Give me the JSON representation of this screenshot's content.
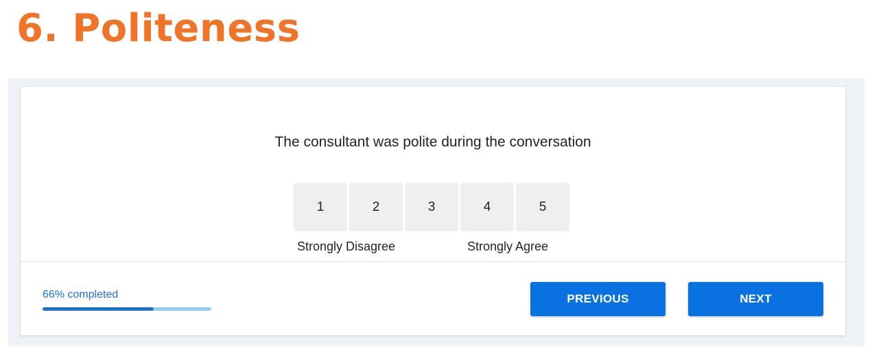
{
  "page": {
    "title": "6. Politeness"
  },
  "question": {
    "text": "The consultant was polite during the conversation",
    "options": [
      "1",
      "2",
      "3",
      "4",
      "5"
    ],
    "scale_min_label": "Strongly Disagree",
    "scale_max_label": "Strongly Agree"
  },
  "progress": {
    "label": "66% completed",
    "percent": 66
  },
  "navigation": {
    "previous_label": "PREVIOUS",
    "next_label": "NEXT"
  },
  "colors": {
    "title": "#f07427",
    "primary": "#0a72e0",
    "progress_fill": "#1b6fd6",
    "progress_track": "#8fd0f6",
    "option_background": "#efefef"
  }
}
